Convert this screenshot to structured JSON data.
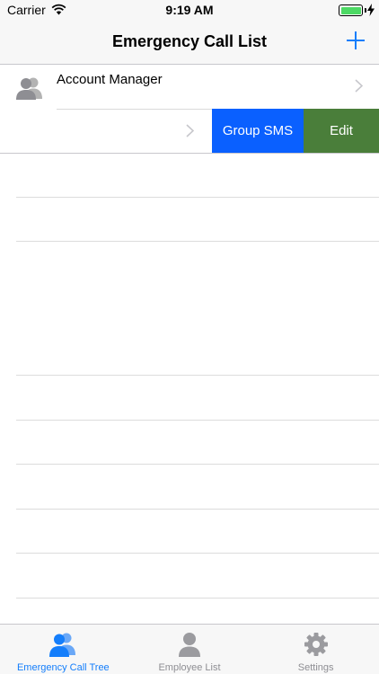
{
  "status_bar": {
    "carrier": "Carrier",
    "time": "9:19 AM"
  },
  "nav": {
    "title": "Emergency Call List",
    "add_icon": "plus-icon"
  },
  "list": {
    "items": [
      {
        "title": "Account Manager",
        "icon": "group-icon"
      }
    ],
    "swipe_actions": {
      "group_sms": "Group SMS",
      "edit": "Edit"
    }
  },
  "tabs": [
    {
      "label": "Emergency Call Tree",
      "icon": "group-icon",
      "active": true
    },
    {
      "label": "Employee List",
      "icon": "person-icon",
      "active": false
    },
    {
      "label": "Settings",
      "icon": "gear-icon",
      "active": false
    }
  ],
  "colors": {
    "accent": "#147efb",
    "sms_action": "#0a60ff",
    "edit_action": "#4a7e3a",
    "battery": "#4cd964"
  }
}
